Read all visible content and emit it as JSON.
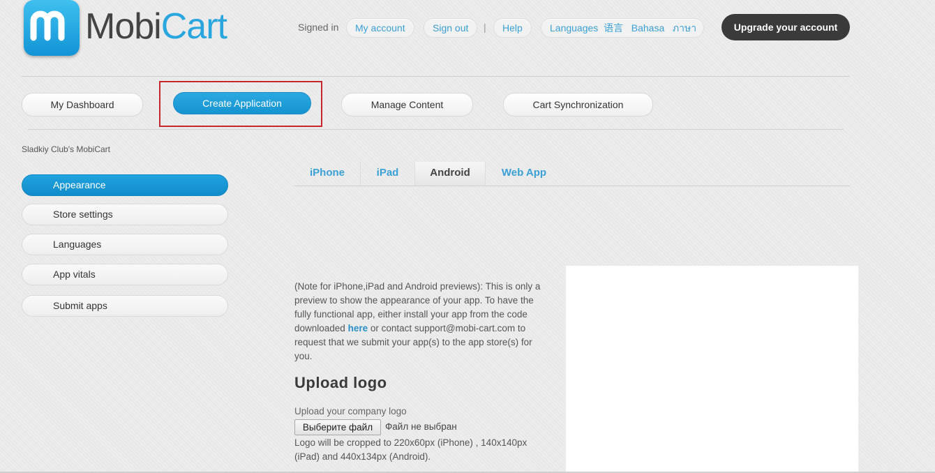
{
  "brand": {
    "mobi": "Mobi",
    "cart": "Cart"
  },
  "header": {
    "signed_in": "Signed in",
    "my_account": "My account",
    "sign_out": "Sign out",
    "separator": "|",
    "help": "Help",
    "languages": "Languages",
    "lang_chinese": "语言",
    "lang_bahasa": "Bahasa",
    "lang_thai": "ภาษา",
    "upgrade": "Upgrade your account"
  },
  "nav": {
    "dashboard": "My Dashboard",
    "create": "Create Application",
    "manage": "Manage Content",
    "sync": "Cart Synchronization"
  },
  "store_name": "Sladkiy Club's MobiCart",
  "sidebar": {
    "items": [
      {
        "label": "Appearance"
      },
      {
        "label": "Store settings"
      },
      {
        "label": "Languages"
      },
      {
        "label": "App vitals"
      },
      {
        "label": "Submit apps"
      }
    ]
  },
  "tabs": [
    {
      "label": "iPhone"
    },
    {
      "label": "iPad"
    },
    {
      "label": "Android"
    },
    {
      "label": "Web App"
    }
  ],
  "note": {
    "before": "(Note for iPhone,iPad and Android previews): This is only a preview to show the appearance of your app. To have the fully functional app, either install your app from the code downloaded ",
    "link": "here",
    "after": " or contact support@mobi-cart.com to request that we submit your app(s) to the app store(s) for you."
  },
  "upload": {
    "heading": "Upload logo",
    "label": "Upload your company logo",
    "button": "Выберите файл",
    "no_file": "Файл не выбран",
    "crop_note": "Logo will be cropped to  220x60px (iPhone) , 140x140px (iPad) and 440x134px (Android)."
  },
  "colors": {
    "accent": "#1d9ad8",
    "highlight": "#c8262c",
    "dark": "#3a3a3a"
  }
}
